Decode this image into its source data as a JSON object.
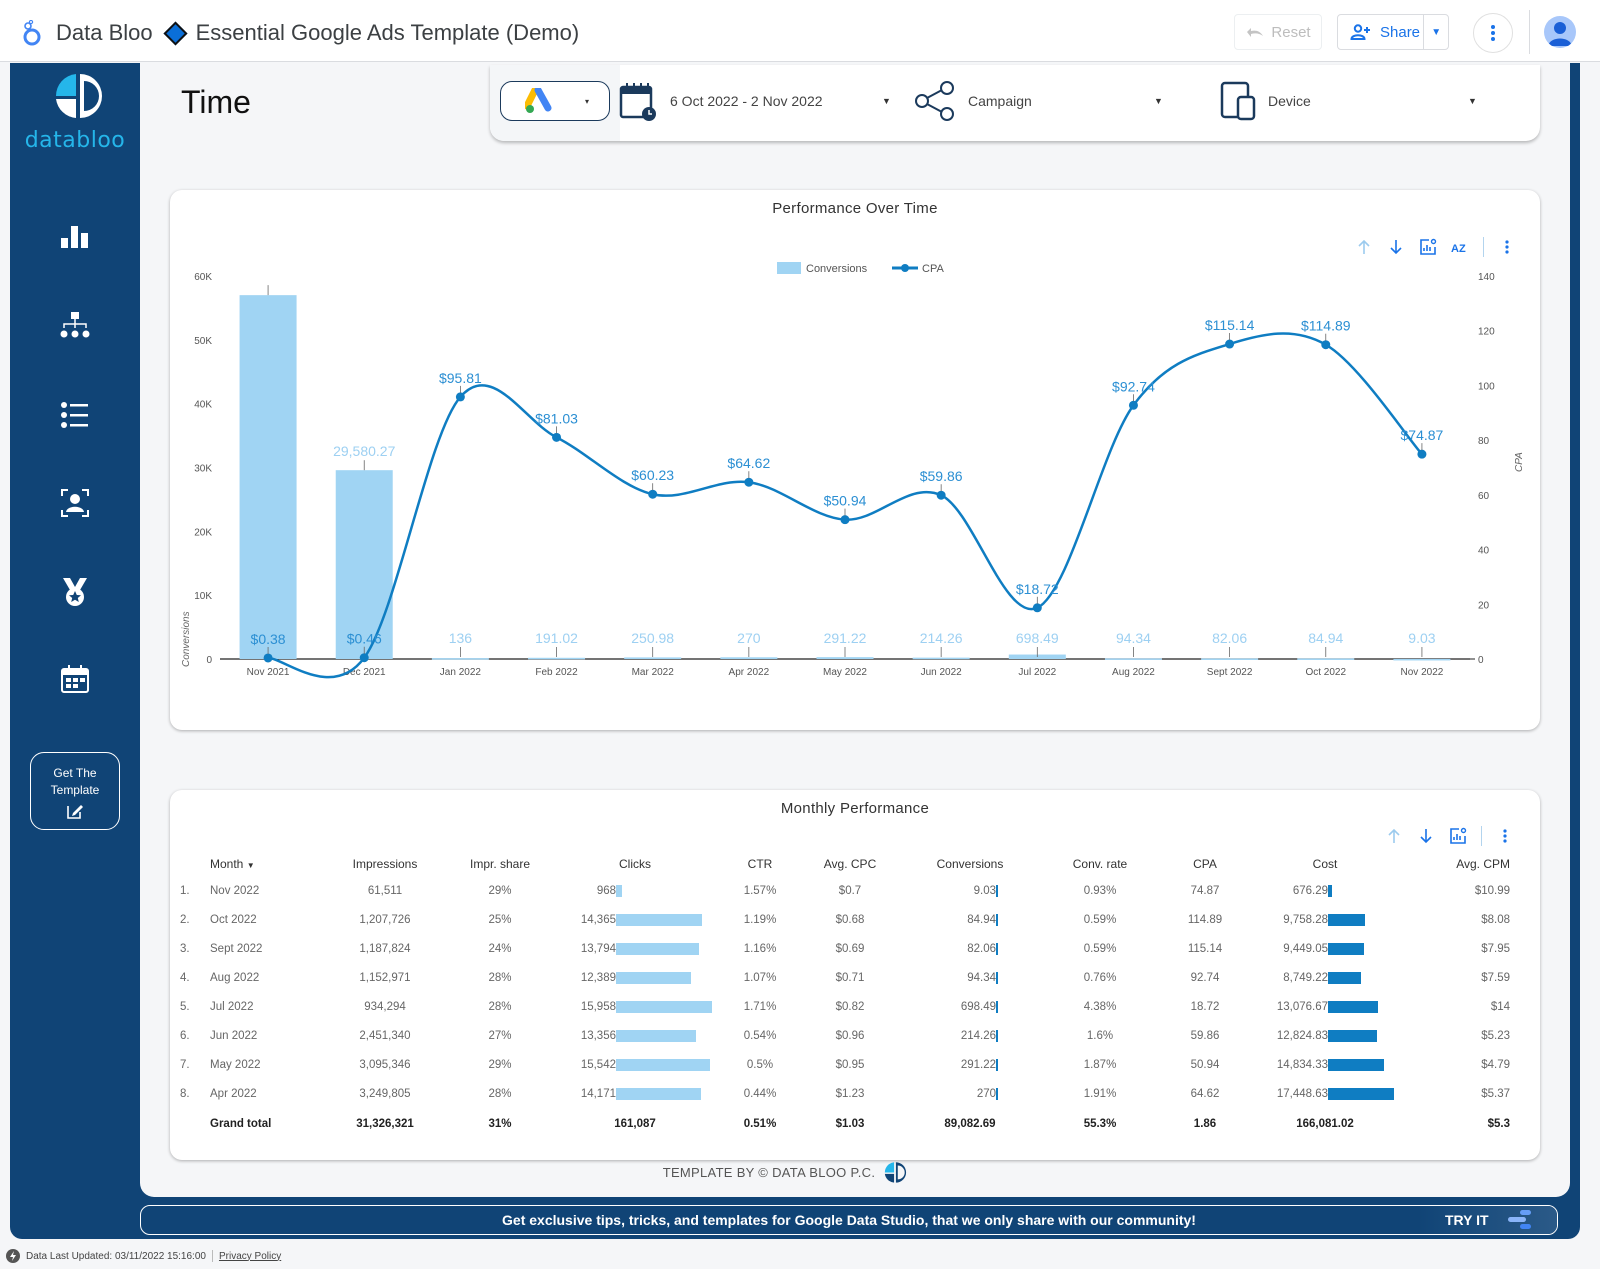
{
  "app": {
    "name": "Data Bloo",
    "report_title": "Essential Google Ads Template (Demo)",
    "reset_label": "Reset",
    "share_label": "Share"
  },
  "sidebar": {
    "brand": "databloo",
    "items": [
      {
        "icon": "bar-chart-icon",
        "label": "Overview"
      },
      {
        "icon": "hierarchy-icon",
        "label": "Campaigns"
      },
      {
        "icon": "list-icon",
        "label": "Keywords"
      },
      {
        "icon": "audience-icon",
        "label": "Audience"
      },
      {
        "icon": "medal-icon",
        "label": "Performance"
      },
      {
        "icon": "calendar-icon",
        "label": "Time"
      }
    ],
    "cta_line1": "Get The",
    "cta_line2": "Template"
  },
  "page": {
    "title": "Time"
  },
  "filters": {
    "date_range": "6 Oct 2022 - 2 Nov 2022",
    "campaign": "Campaign",
    "device": "Device"
  },
  "chart_data": {
    "type": "bar",
    "title": "Performance Over Time",
    "categories": [
      "Nov 2021",
      "Dec 2021",
      "Jan 2022",
      "Feb 2022",
      "Mar 2022",
      "Apr 2022",
      "May 2022",
      "Jun 2022",
      "Jul 2022",
      "Aug 2022",
      "Sept 2022",
      "Oct 2022",
      "Nov 2022"
    ],
    "series": [
      {
        "name": "Conversions",
        "type": "bar",
        "axis": "left",
        "color": "#a0d4f3",
        "values": [
          57000,
          29580.27,
          136,
          191.02,
          250.98,
          270,
          291.22,
          214.26,
          698.49,
          94.34,
          82.06,
          84.94,
          9.03
        ],
        "labels": [
          "",
          "29,580.27",
          "136",
          "191.02",
          "250.98",
          "270",
          "291.22",
          "214.26",
          "698.49",
          "94.34",
          "82.06",
          "84.94",
          "9.03"
        ]
      },
      {
        "name": "CPA",
        "type": "line",
        "axis": "right",
        "color": "#0f7dc2",
        "values": [
          0.38,
          0.46,
          95.81,
          81.03,
          60.23,
          64.62,
          50.94,
          59.86,
          18.72,
          92.74,
          115.14,
          114.89,
          74.87
        ],
        "labels": [
          "$0.38",
          "$0.46",
          "$95.81",
          "$81.03",
          "$60.23",
          "$64.62",
          "$50.94",
          "$59.86",
          "$18.72",
          "$92.74",
          "$115.14",
          "$114.89",
          "$74.87"
        ]
      }
    ],
    "ylabel": "Conversions",
    "y2label": "CPA",
    "ylim": [
      0,
      60000
    ],
    "yticks": [
      "0",
      "10K",
      "20K",
      "30K",
      "40K",
      "50K",
      "60K"
    ],
    "y2lim": [
      0,
      140
    ],
    "y2ticks": [
      "0",
      "20",
      "40",
      "60",
      "80",
      "100",
      "120",
      "140"
    ],
    "legend": "top-center",
    "grid": false
  },
  "table": {
    "title": "Monthly Performance",
    "columns": [
      "Month",
      "Impressions",
      "Impr. share",
      "Clicks",
      "CTR",
      "Avg. CPC",
      "Conversions",
      "Conv. rate",
      "CPA",
      "Cost",
      "Avg. CPM"
    ],
    "rows": [
      {
        "idx": "1.",
        "month": "Nov 2022",
        "impr": "61,511",
        "share": "29%",
        "clicks": "968",
        "clicks_v": 968,
        "ctr": "1.57%",
        "cpc": "$0.7",
        "conv": "9.03",
        "conv_rate": "0.93%",
        "cpa": "74.87",
        "cost": "676.29",
        "cost_v": 676.29,
        "cpm": "$10.99"
      },
      {
        "idx": "2.",
        "month": "Oct 2022",
        "impr": "1,207,726",
        "share": "25%",
        "clicks": "14,365",
        "clicks_v": 14365,
        "ctr": "1.19%",
        "cpc": "$0.68",
        "conv": "84.94",
        "conv_rate": "0.59%",
        "cpa": "114.89",
        "cost": "9,758.28",
        "cost_v": 9758.28,
        "cpm": "$8.08"
      },
      {
        "idx": "3.",
        "month": "Sept 2022",
        "impr": "1,187,824",
        "share": "24%",
        "clicks": "13,794",
        "clicks_v": 13794,
        "ctr": "1.16%",
        "cpc": "$0.69",
        "conv": "82.06",
        "conv_rate": "0.59%",
        "cpa": "115.14",
        "cost": "9,449.05",
        "cost_v": 9449.05,
        "cpm": "$7.95"
      },
      {
        "idx": "4.",
        "month": "Aug 2022",
        "impr": "1,152,971",
        "share": "28%",
        "clicks": "12,389",
        "clicks_v": 12389,
        "ctr": "1.07%",
        "cpc": "$0.71",
        "conv": "94.34",
        "conv_rate": "0.76%",
        "cpa": "92.74",
        "cost": "8,749.22",
        "cost_v": 8749.22,
        "cpm": "$7.59"
      },
      {
        "idx": "5.",
        "month": "Jul 2022",
        "impr": "934,294",
        "share": "28%",
        "clicks": "15,958",
        "clicks_v": 15958,
        "ctr": "1.71%",
        "cpc": "$0.82",
        "conv": "698.49",
        "conv_rate": "4.38%",
        "cpa": "18.72",
        "cost": "13,076.67",
        "cost_v": 13076.67,
        "cpm": "$14"
      },
      {
        "idx": "6.",
        "month": "Jun 2022",
        "impr": "2,451,340",
        "share": "27%",
        "clicks": "13,356",
        "clicks_v": 13356,
        "ctr": "0.54%",
        "cpc": "$0.96",
        "conv": "214.26",
        "conv_rate": "1.6%",
        "cpa": "59.86",
        "cost": "12,824.83",
        "cost_v": 12824.83,
        "cpm": "$5.23"
      },
      {
        "idx": "7.",
        "month": "May 2022",
        "impr": "3,095,346",
        "share": "29%",
        "clicks": "15,542",
        "clicks_v": 15542,
        "ctr": "0.5%",
        "cpc": "$0.95",
        "conv": "291.22",
        "conv_rate": "1.87%",
        "cpa": "50.94",
        "cost": "14,834.33",
        "cost_v": 14834.33,
        "cpm": "$4.79"
      },
      {
        "idx": "8.",
        "month": "Apr 2022",
        "impr": "3,249,805",
        "share": "28%",
        "clicks": "14,171",
        "clicks_v": 14171,
        "ctr": "0.44%",
        "cpc": "$1.23",
        "conv": "270",
        "conv_rate": "1.91%",
        "cpa": "64.62",
        "cost": "17,448.63",
        "cost_v": 17448.63,
        "cpm": "$5.37"
      }
    ],
    "total": {
      "label": "Grand total",
      "impr": "31,326,321",
      "share": "31%",
      "clicks": "161,087",
      "ctr": "0.51%",
      "cpc": "$1.03",
      "conv": "89,082.69",
      "conv_rate": "55.3%",
      "cpa": "1.86",
      "cost": "166,081.02",
      "cpm": "$5.3"
    }
  },
  "footer": {
    "credit": "TEMPLATE BY © DATA BLOO P.C.",
    "promo": "Get exclusive tips, tricks, and templates for Google Data Studio, that we only share with our community!",
    "try_it": "TRY IT",
    "last_updated": "Data Last Updated: 03/11/2022 15:16:00",
    "privacy": "Privacy Policy"
  },
  "colors": {
    "navy": "#104476",
    "bar_light": "#a0d4f3",
    "line_blue": "#0f7dc2",
    "brand_cyan": "#25b6ea",
    "google_blue": "#1a73e8"
  }
}
